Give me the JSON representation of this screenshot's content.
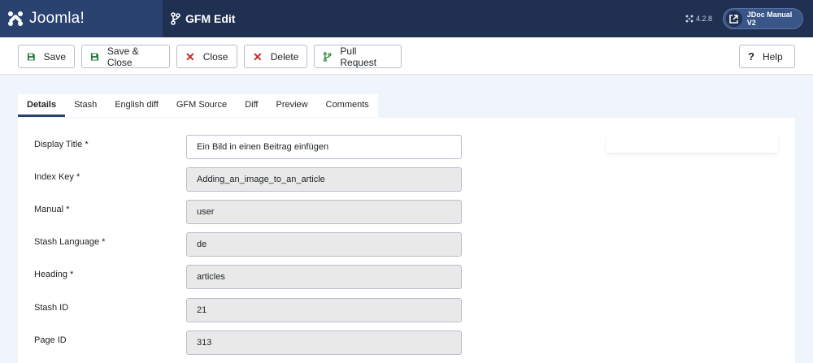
{
  "header": {
    "logo_text": "Joomla!",
    "page_title": "GFM Edit",
    "version": "4.2.8",
    "site_button_label": "JDoc Manual V2"
  },
  "toolbar": {
    "save": "Save",
    "save_close": "Save & Close",
    "close": "Close",
    "delete": "Delete",
    "pull_request": "Pull Request",
    "help": "Help"
  },
  "tabs": [
    "Details",
    "Stash",
    "English diff",
    "GFM Source",
    "Diff",
    "Preview",
    "Comments"
  ],
  "form": {
    "fields": [
      {
        "label": "Display Title *",
        "value": "Ein Bild in einen Beitrag einfügen"
      },
      {
        "label": "Index Key *",
        "value": "Adding_an_image_to_an_article"
      },
      {
        "label": "Manual *",
        "value": "user"
      },
      {
        "label": "Stash Language *",
        "value": "de"
      },
      {
        "label": "Heading *",
        "value": "articles"
      },
      {
        "label": "Stash ID",
        "value": "21"
      },
      {
        "label": "Page ID",
        "value": "313"
      }
    ]
  },
  "colors": {
    "header_bg": "#1f3050",
    "logo_bg": "#2a4270",
    "save_icon": "#1f7a3b",
    "delete_icon": "#c52827",
    "pull_request_icon": "#2e8540"
  }
}
